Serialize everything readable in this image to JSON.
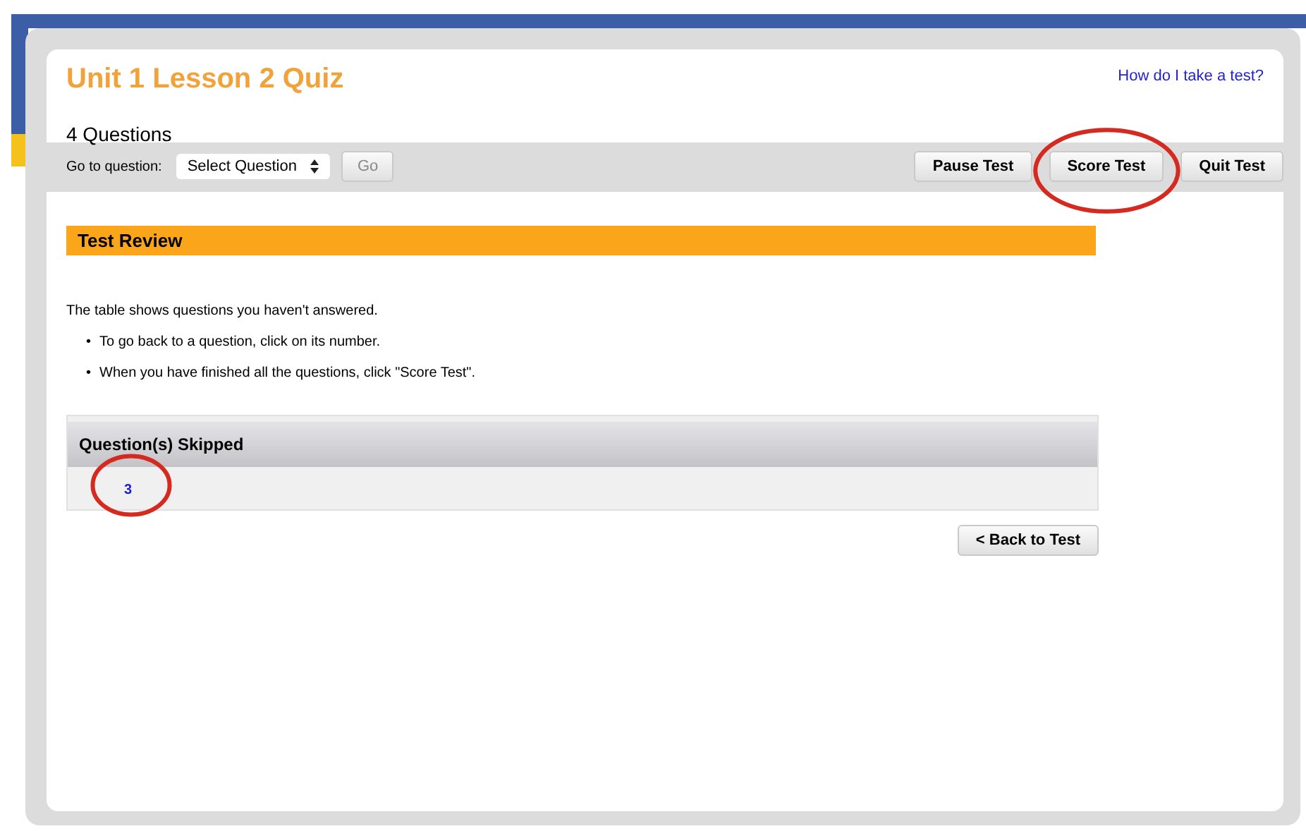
{
  "header": {
    "title": "Unit 1 Lesson 2 Quiz",
    "help_link": "How do I take a test?",
    "question_count": "4 Questions"
  },
  "toolbar": {
    "goto_label": "Go to question:",
    "select": {
      "value": "Select Question"
    },
    "go_button": {
      "label": "Go",
      "disabled": true
    },
    "buttons": [
      {
        "label": "Pause Test",
        "circled": false
      },
      {
        "label": "Score Test",
        "circled": true
      },
      {
        "label": "Quit Test",
        "circled": false
      }
    ]
  },
  "review": {
    "title": "Test Review",
    "intro": "The table shows questions you haven't answered.",
    "bullets": [
      {
        "marker": "•",
        "text": "To go back to a question, click on its number."
      },
      {
        "marker": "•",
        "text": "When you have finished all the questions, click \"Score Test\"."
      }
    ],
    "table": {
      "column": "Question(s) Skipped",
      "rows": [
        {
          "number": "3",
          "circled": true
        }
      ]
    },
    "back_button": "< Back to Test"
  }
}
